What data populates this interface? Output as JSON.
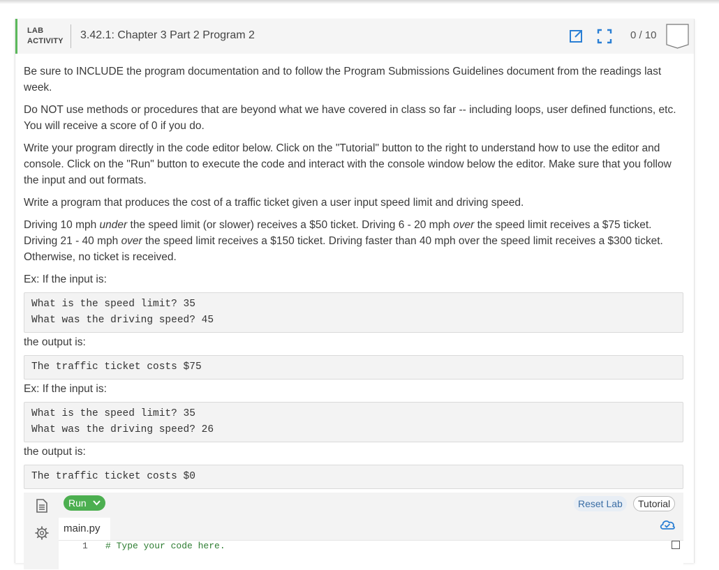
{
  "header": {
    "lab_label_line1": "LAB",
    "lab_label_line2": "ACTIVITY",
    "title": "3.42.1: Chapter 3 Part 2 Program 2",
    "score": "0 / 10",
    "accent_color": "#5cb85c",
    "icons": [
      "external-link-icon",
      "fullscreen-icon",
      "score-badge-icon"
    ]
  },
  "instructions": {
    "p1": "Be sure to INCLUDE the program documentation and to follow the Program Submissions Guidelines document from the readings last week.",
    "p2": "Do NOT use methods or procedures that are beyond what we have covered in class so far -- including loops, user defined functions, etc. You will receive a score of 0 if you do.",
    "p3": "Write your program directly in the code editor below. Click on the \"Tutorial\" button to the right to understand how to use the editor and console. Click on the \"Run\" button to execute the code and interact with the console window below the editor. Make sure that you follow the input and out formats.",
    "p4": "Write a program that produces the cost of a traffic ticket given a user input speed limit and driving speed.",
    "p5": {
      "a": "Driving 10 mph ",
      "b": "under",
      "c": " the speed limit (or slower) receives a $50 ticket. Driving 6 - 20 mph ",
      "d": "over",
      "e": " the speed limit receives a $75 ticket. Driving 21 - 40 mph ",
      "f": "over",
      "g": " the speed limit receives a $150 ticket. Driving faster than 40 mph over the speed limit receives a $300 ticket. Otherwise, no ticket is received."
    }
  },
  "examples": [
    {
      "intro": "Ex: If the input is:",
      "input_lines": [
        "What is the speed limit? 35",
        "What was the driving speed? 45"
      ],
      "output_intro": "the output is:",
      "output": "The traffic ticket costs $75"
    },
    {
      "intro": "Ex: If the input is:",
      "input_lines": [
        "What is the speed limit? 35",
        "What was the driving speed? 26"
      ],
      "output_intro": "the output is:",
      "output": "The traffic ticket costs $0"
    }
  ],
  "editor": {
    "run_label": "Run",
    "reset_label": "Reset Lab",
    "tutorial_label": "Tutorial",
    "file_tab": "main.py",
    "line_number": "1",
    "code_line": "# Type your code here.",
    "run_color": "#4caf50",
    "icons": [
      "file-icon",
      "gear-icon",
      "chevron-down-icon",
      "cloud-saved-icon"
    ]
  }
}
